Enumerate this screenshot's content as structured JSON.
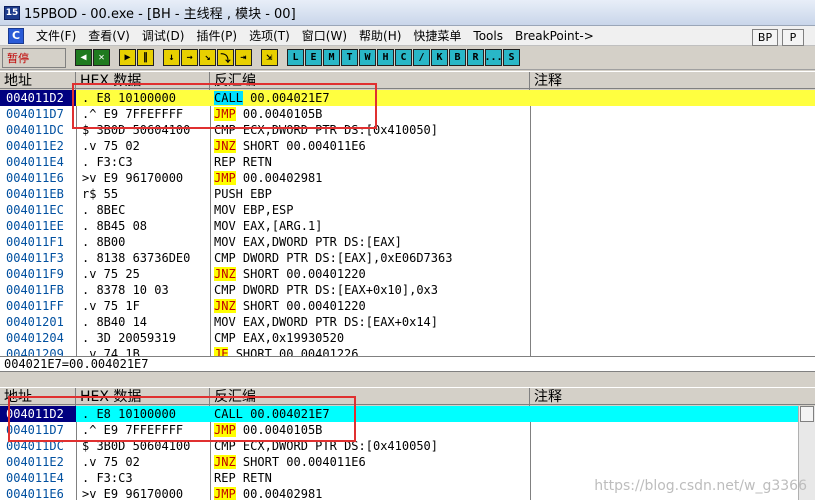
{
  "window": {
    "icon_text": "15",
    "title": "15PBOD - 00.exe - [BH - 主线程 , 模块 - 00]"
  },
  "menu": {
    "c_icon": "C",
    "items": [
      "文件(F)",
      "查看(V)",
      "调试(D)",
      "插件(P)",
      "选项(T)",
      "窗口(W)",
      "帮助(H)",
      "快捷菜单",
      "Tools",
      "BreakPoint->"
    ],
    "right_buttons": [
      "BP",
      "P"
    ]
  },
  "toolbar": {
    "status": "暂停",
    "buttons": [
      {
        "icon": "restart-icon",
        "text": "◀",
        "style": "play"
      },
      {
        "icon": "close-icon",
        "text": "✕",
        "style": "play"
      },
      {
        "icon": "run-icon",
        "text": "▶",
        "style": "yel"
      },
      {
        "icon": "pause-icon",
        "text": "∥",
        "style": "yel"
      },
      {
        "icon": "step-into-icon",
        "text": "↓",
        "style": "yel"
      },
      {
        "icon": "step-over-icon",
        "text": "→",
        "style": "yel"
      },
      {
        "icon": "trace-into-icon",
        "text": "↘",
        "style": "yel"
      },
      {
        "icon": "trace-over-icon",
        "text": "⤵",
        "style": "yel"
      },
      {
        "icon": "execute-till-return-icon",
        "text": "⇥",
        "style": "yel"
      },
      {
        "icon": "goto-icon",
        "text": "⇲",
        "style": "yel"
      }
    ],
    "letter_buttons": [
      "L",
      "E",
      "M",
      "T",
      "W",
      "H",
      "C",
      "/",
      "K",
      "B",
      "R",
      "...",
      "S"
    ]
  },
  "pane_top": {
    "headers": {
      "addr": "地址",
      "hex": "HEX 数据",
      "dis": "反汇编",
      "comment": "注释"
    },
    "rows": [
      {
        "addr": "004011D2",
        "hex": ".  E8 10100000",
        "op": "CALL",
        "arg": "00.004021E7",
        "hl": "call",
        "sel": "yel"
      },
      {
        "addr": "004011D7",
        "hex": ".^ E9 7FFEFFFF",
        "op": "JMP",
        "arg": "00.0040105B",
        "hl": "jmp"
      },
      {
        "addr": "004011DC",
        "hex": "$  3B0D 50604100",
        "op": "CMP",
        "arg": "ECX,DWORD PTR DS:[0x410050]",
        "hl": ""
      },
      {
        "addr": "004011E2",
        "hex": ".v 75 02",
        "op": "JNZ",
        "arg": "SHORT 00.004011E6",
        "hl": "jnz"
      },
      {
        "addr": "004011E4",
        "hex": ".  F3:C3",
        "op": "REP",
        "arg": "RETN",
        "hl": ""
      },
      {
        "addr": "004011E6",
        "hex": ">v E9 96170000",
        "op": "JMP",
        "arg": "00.00402981",
        "hl": "jmp"
      },
      {
        "addr": "004011EB",
        "hex": "r$ 55",
        "op": "PUSH",
        "arg": "EBP",
        "hl": ""
      },
      {
        "addr": "004011EC",
        "hex": ".  8BEC",
        "op": "MOV",
        "arg": "EBP,ESP",
        "hl": ""
      },
      {
        "addr": "004011EE",
        "hex": ".  8B45 08",
        "op": "MOV",
        "arg": "EAX,[ARG.1]",
        "hl": ""
      },
      {
        "addr": "004011F1",
        "hex": ".  8B00",
        "op": "MOV",
        "arg": "EAX,DWORD PTR DS:[EAX]",
        "hl": ""
      },
      {
        "addr": "004011F3",
        "hex": ".  8138 63736DE0",
        "op": "CMP",
        "arg": "DWORD PTR DS:[EAX],0xE06D7363",
        "hl": ""
      },
      {
        "addr": "004011F9",
        "hex": ".v 75 25",
        "op": "JNZ",
        "arg": "SHORT 00.00401220",
        "hl": "jnz"
      },
      {
        "addr": "004011FB",
        "hex": ".  8378 10 03",
        "op": "CMP",
        "arg": "DWORD PTR DS:[EAX+0x10],0x3",
        "hl": ""
      },
      {
        "addr": "004011FF",
        "hex": ".v 75 1F",
        "op": "JNZ",
        "arg": "SHORT 00.00401220",
        "hl": "jnz"
      },
      {
        "addr": "00401201",
        "hex": ".  8B40 14",
        "op": "MOV",
        "arg": "EAX,DWORD PTR DS:[EAX+0x14]",
        "hl": ""
      },
      {
        "addr": "00401204",
        "hex": ".  3D 20059319",
        "op": "CMP",
        "arg": "EAX,0x19930520",
        "hl": ""
      },
      {
        "addr": "00401209",
        "hex": ".v 74 1B",
        "op": "JE",
        "arg": "SHORT 00.00401226",
        "hl": "je"
      }
    ]
  },
  "info_line": "004021E7=00.004021E7",
  "pane_bottom": {
    "headers": {
      "addr": "地址",
      "hex": "HEX 数据",
      "dis": "反汇编",
      "comment": "注释"
    },
    "rows": [
      {
        "addr": "004011D2",
        "hex": ".  E8 10100000",
        "op": "CALL",
        "arg": "00.004021E7",
        "hl": "",
        "sel": "cyan"
      },
      {
        "addr": "004011D7",
        "hex": ".^ E9 7FFEFFFF",
        "op": "JMP",
        "arg": "00.0040105B",
        "hl": "jmp"
      },
      {
        "addr": "004011DC",
        "hex": "$  3B0D 50604100",
        "op": "CMP",
        "arg": "ECX,DWORD PTR DS:[0x410050]",
        "hl": ""
      },
      {
        "addr": "004011E2",
        "hex": ".v 75 02",
        "op": "JNZ",
        "arg": "SHORT 00.004011E6",
        "hl": "jnz"
      },
      {
        "addr": "004011E4",
        "hex": ".  F3:C3",
        "op": "REP",
        "arg": "RETN",
        "hl": ""
      },
      {
        "addr": "004011E6",
        "hex": ">v E9 96170000",
        "op": "JMP",
        "arg": "00.00402981",
        "hl": "jmp"
      }
    ]
  },
  "watermark": "https://blog.csdn.net/w_g3366"
}
